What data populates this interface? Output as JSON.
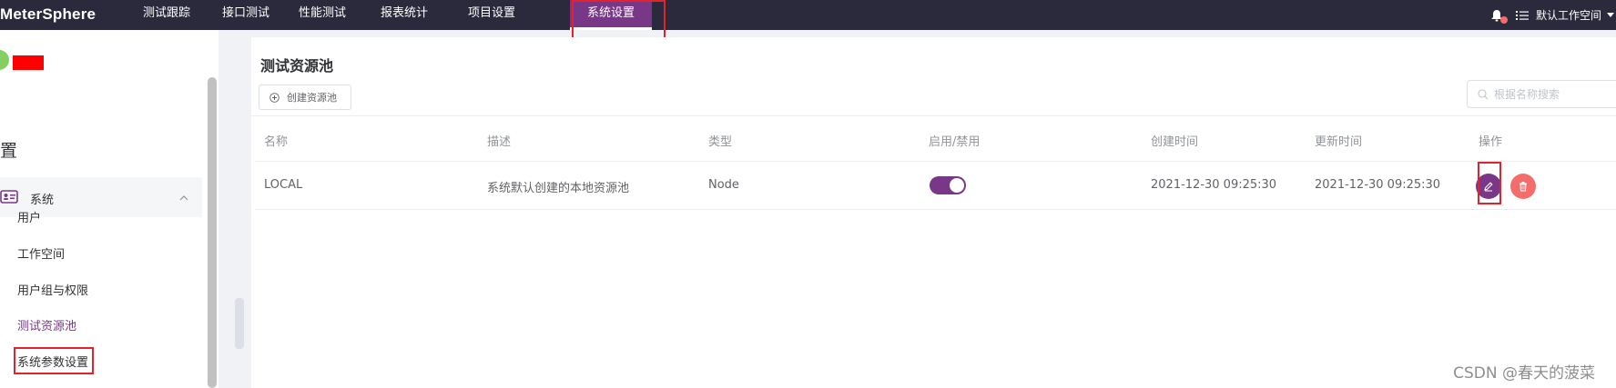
{
  "header": {
    "logo": "MeterSphere",
    "nav": [
      {
        "label": "测试跟踪"
      },
      {
        "label": "接口测试"
      },
      {
        "label": "性能测试"
      },
      {
        "label": "报表统计"
      },
      {
        "label": "项目设置"
      },
      {
        "label": "系统设置",
        "active": true
      }
    ],
    "workspace": "默认工作空间",
    "icons": [
      "bell-icon",
      "list-icon",
      "caret-down-icon"
    ]
  },
  "sidebar": {
    "heading": "置",
    "group": {
      "label": "系统",
      "icon": "id-card-icon",
      "expanded": true
    },
    "items": [
      {
        "label": "用户"
      },
      {
        "label": "工作空间"
      },
      {
        "label": "用户组与权限"
      },
      {
        "label": "测试资源池",
        "active": true
      },
      {
        "label": "系统参数设置"
      }
    ]
  },
  "main": {
    "title": "测试资源池",
    "create_button": "创建资源池",
    "search_placeholder": "根据名称搜索",
    "columns": [
      "名称",
      "描述",
      "类型",
      "启用/禁用",
      "创建时间",
      "更新时间",
      "操作"
    ],
    "rows": [
      {
        "name": "LOCAL",
        "description": "系统默认创建的本地资源池",
        "type": "Node",
        "enabled": true,
        "created": "2021-12-30 09:25:30",
        "updated": "2021-12-30 09:25:30"
      }
    ]
  },
  "watermark": "CSDN @春天的菠菜",
  "colors": {
    "topbar": "#2b2a3d",
    "accent": "#783887",
    "danger": "#f56c6c",
    "annotation": "#e4222d"
  }
}
